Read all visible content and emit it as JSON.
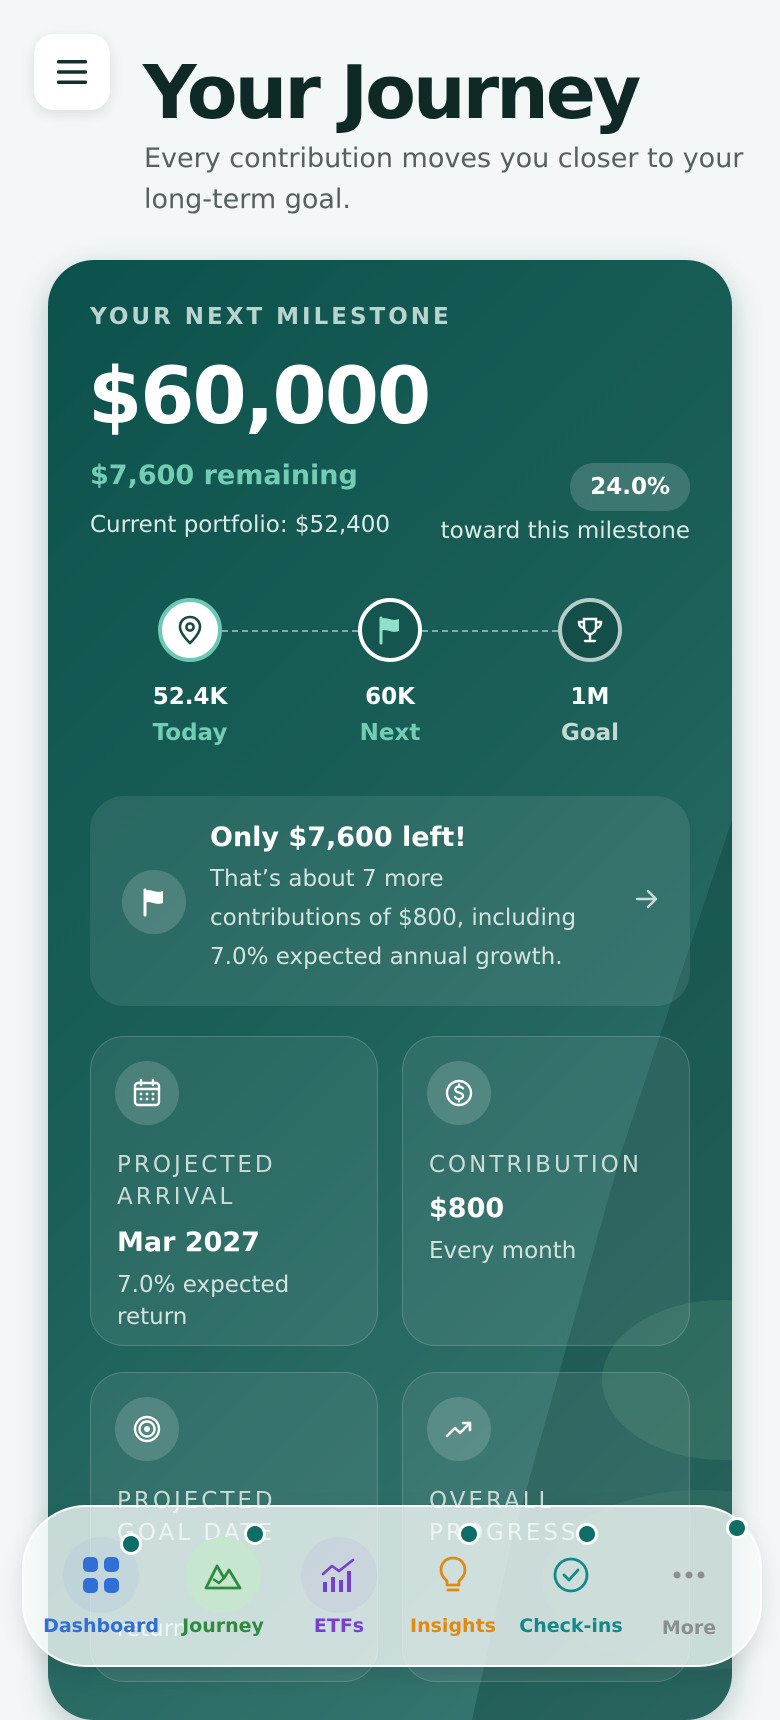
{
  "header": {
    "title": "Your Journey",
    "subtitle": "Every contribution moves you closer to your long-term goal."
  },
  "milestone": {
    "label": "YOUR NEXT MILESTONE",
    "amount": "$60,000",
    "remaining": "$7,600 remaining",
    "portfolio": "Current portfolio: $52,400",
    "percent": "24.0%",
    "percent_caption": "toward this milestone",
    "progress_fraction": 0.24
  },
  "track": {
    "nodes": [
      {
        "value": "52.4K",
        "label": "Today",
        "icon": "location-pin-icon"
      },
      {
        "value": "60K",
        "label": "Next",
        "icon": "flag-icon"
      },
      {
        "value": "1M",
        "label": "Goal",
        "icon": "trophy-icon"
      }
    ]
  },
  "callout": {
    "title": "Only $7,600 left!",
    "body": "That’s about 7 more contributions of $800, including 7.0% expected annual growth.",
    "icon": "flag-icon"
  },
  "tiles": [
    {
      "label": "PROJECTED ARRIVAL",
      "value": "Mar 2027",
      "sub": "7.0% expected return",
      "icon": "calendar-icon"
    },
    {
      "label": "CONTRIBUTION",
      "value": "$800",
      "sub": "Every month",
      "icon": "dollar-coin-icon"
    },
    {
      "label": "PROJECTED GOAL DATE",
      "value": "",
      "sub": "return",
      "icon": "target-icon"
    },
    {
      "label": "OVERALL PROGRESS",
      "value": "",
      "sub": "",
      "icon": "trending-up-icon"
    }
  ],
  "nav": {
    "items": [
      {
        "label": "Dashboard",
        "color": "#2f6fd6",
        "icon": "grid-icon"
      },
      {
        "label": "Journey",
        "color": "#2e8b3e",
        "icon": "mountain-icon"
      },
      {
        "label": "ETFs",
        "color": "#7a3fd1",
        "icon": "chart-icon"
      },
      {
        "label": "Insights",
        "color": "#e08a12",
        "icon": "lightbulb-icon"
      },
      {
        "label": "Check-ins",
        "color": "#128a8a",
        "icon": "check-circle-icon"
      },
      {
        "label": "More",
        "color": "#8b8f90",
        "icon": "more-dots-icon"
      }
    ]
  },
  "colors": {
    "accent": "#73cdb4",
    "card_bg": "#0c524c",
    "active_nav_bg": "#c6e6cf"
  }
}
